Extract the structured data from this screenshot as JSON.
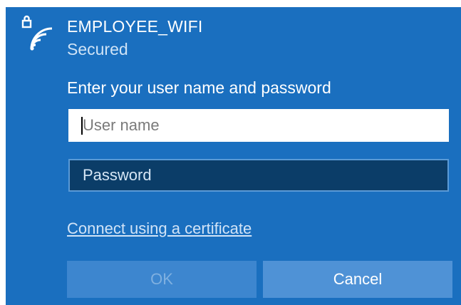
{
  "network": {
    "name": "EMPLOYEE_WIFI",
    "status": "Secured",
    "icon": "secured-wifi-icon"
  },
  "form": {
    "prompt": "Enter your user name and password",
    "username_placeholder": "User name",
    "username_value": "",
    "password_placeholder": "Password",
    "password_value": "",
    "certificate_link": "Connect using a certificate"
  },
  "buttons": {
    "ok_label": "OK",
    "ok_enabled": false,
    "cancel_label": "Cancel"
  },
  "colors": {
    "panel_background": "#1a6fbf",
    "password_field_background": "#0b3d68",
    "ok_button_background": "#3d86cf",
    "cancel_button_background": "#4f92d6",
    "link_text": "#d2e4f7"
  }
}
